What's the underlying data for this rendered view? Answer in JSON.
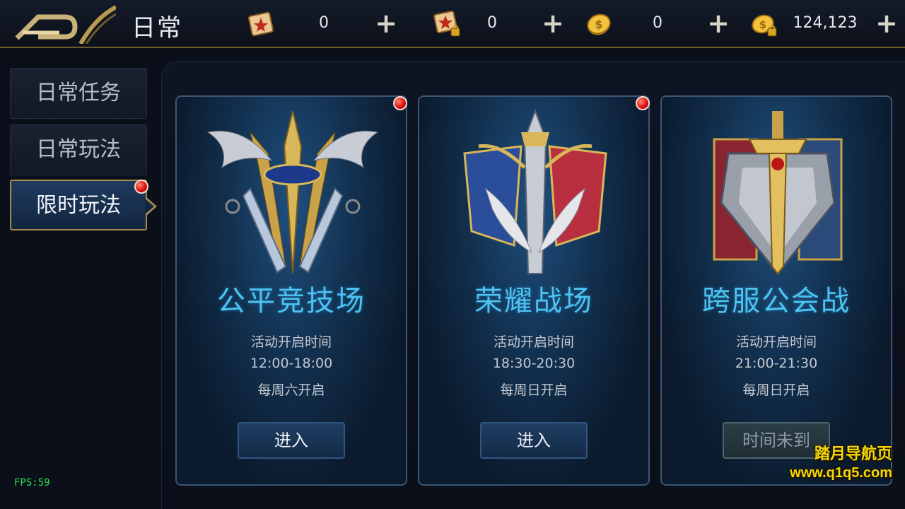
{
  "header": {
    "title": "日常",
    "currencies": [
      {
        "icon": "scroll-star-icon",
        "value": "0"
      },
      {
        "icon": "scroll-locked-icon",
        "value": "0"
      },
      {
        "icon": "gold-coin-icon",
        "value": "0"
      },
      {
        "icon": "gold-coin-locked-icon",
        "value": "124,123"
      }
    ],
    "plus_label": "+"
  },
  "sidebar": {
    "items": [
      {
        "label": "日常任务",
        "active": false
      },
      {
        "label": "日常玩法",
        "active": false
      },
      {
        "label": "限时玩法",
        "active": true,
        "red_dot": true
      }
    ]
  },
  "cards": [
    {
      "title": "公平竞技场",
      "info_label": "活动开启时间",
      "time": "12:00-18:00",
      "schedule": "每周六开启",
      "button": "进入",
      "button_enabled": true,
      "red_dot": true,
      "emblem": "crossed-swords-trident-emblem-icon"
    },
    {
      "title": "荣耀战场",
      "info_label": "活动开启时间",
      "time": "18:30-20:30",
      "schedule": "每周日开启",
      "button": "进入",
      "button_enabled": true,
      "red_dot": true,
      "emblem": "winged-sword-banner-emblem-icon"
    },
    {
      "title": "跨服公会战",
      "info_label": "活动开启时间",
      "time": "21:00-21:30",
      "schedule": "每周日开启",
      "button": "时间未到",
      "button_enabled": false,
      "red_dot": false,
      "emblem": "guild-sword-shield-emblem-icon"
    }
  ],
  "overlay": {
    "fps": "FPS:59",
    "watermark_line1": "踏月导航页",
    "watermark_line2": "www.q1q5.com"
  },
  "colors": {
    "accent_gold": "#a88a4a",
    "title_blue": "#4cc4ef",
    "fps_green": "#2ee04a",
    "watermark_yellow": "#f5d80a"
  }
}
